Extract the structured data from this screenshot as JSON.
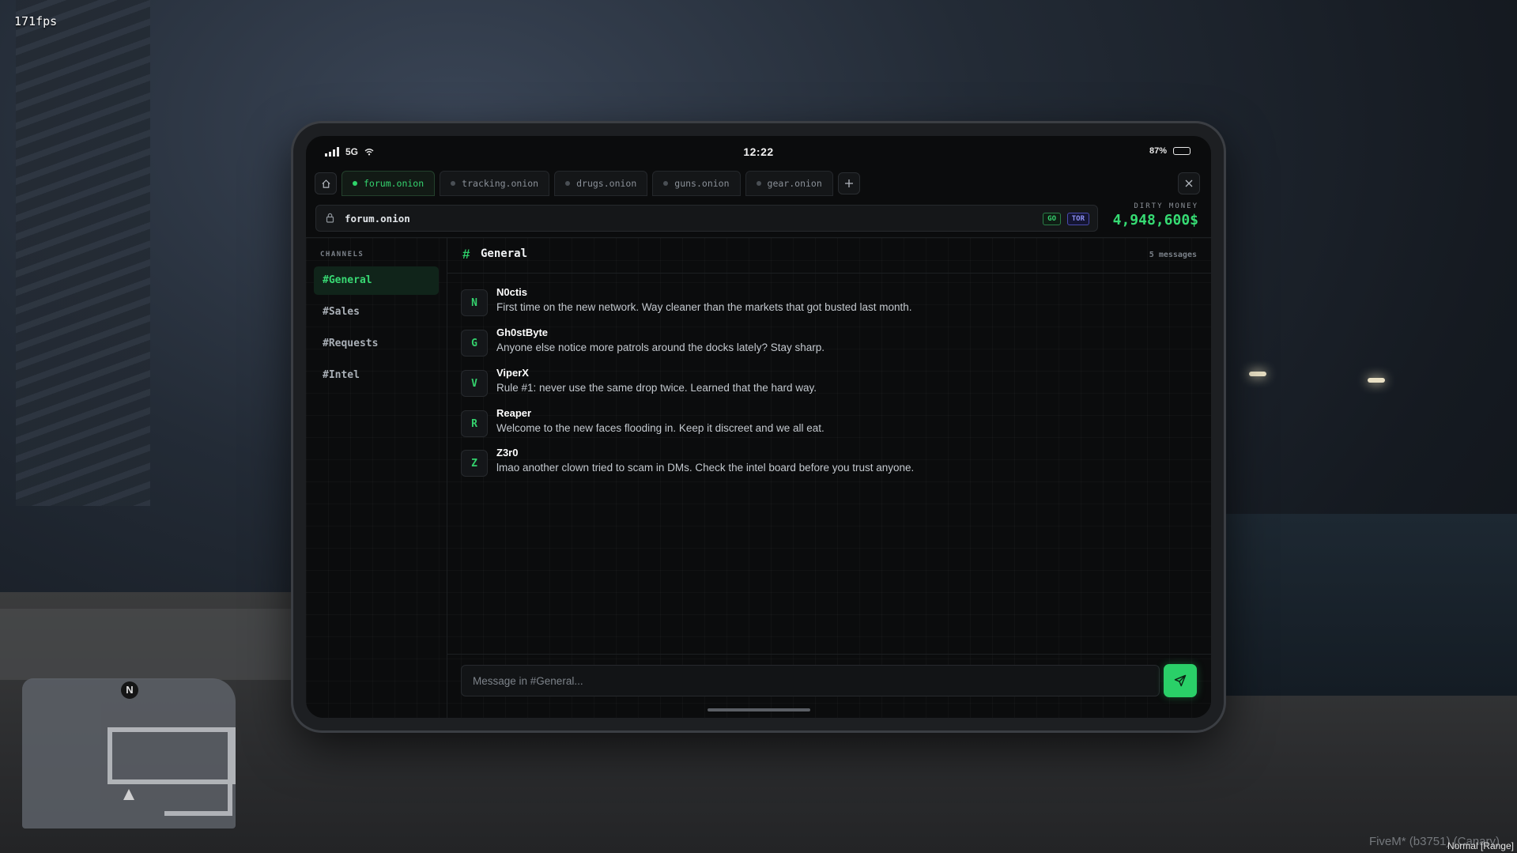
{
  "overlay": {
    "fps": "171fps",
    "watermark": "FiveM* (b3751) (Canary)",
    "voice_mode": "Normal [Range]",
    "minimap_north": "N"
  },
  "status_bar": {
    "signal_label": "5G",
    "time": "12:22",
    "battery_percent_label": "87%",
    "battery_level": 0.87
  },
  "tabs": [
    {
      "label": "forum.onion",
      "active": true
    },
    {
      "label": "tracking.onion",
      "active": false
    },
    {
      "label": "drugs.onion",
      "active": false
    },
    {
      "label": "guns.onion",
      "active": false
    },
    {
      "label": "gear.onion",
      "active": false
    }
  ],
  "url_bar": {
    "url": "forum.onion",
    "go_badge": "GO",
    "tor_badge": "TOR"
  },
  "wallet": {
    "label": "DIRTY MONEY",
    "amount": "4,948,600$"
  },
  "sidebar": {
    "title": "CHANNELS",
    "channels": [
      {
        "label": "#General",
        "active": true
      },
      {
        "label": "#Sales",
        "active": false
      },
      {
        "label": "#Requests",
        "active": false
      },
      {
        "label": "#Intel",
        "active": false
      }
    ]
  },
  "channel": {
    "hash": "#",
    "name": "General",
    "count": "5 messages"
  },
  "messages": [
    {
      "initial": "N",
      "author": "N0ctis",
      "text": "First time on the new network. Way cleaner than the markets that got busted last month."
    },
    {
      "initial": "G",
      "author": "Gh0stByte",
      "text": "Anyone else notice more patrols around the docks lately? Stay sharp."
    },
    {
      "initial": "V",
      "author": "ViperX",
      "text": "Rule #1: never use the same drop twice. Learned that the hard way."
    },
    {
      "initial": "R",
      "author": "Reaper",
      "text": "Welcome to the new faces flooding in. Keep it discreet and we all eat."
    },
    {
      "initial": "Z",
      "author": "Z3r0",
      "text": "lmao another clown tried to scam in DMs. Check the intel board before you trust anyone."
    }
  ],
  "composer": {
    "placeholder": "Message in #General..."
  },
  "colors": {
    "accent": "#2ad068",
    "tor": "#8c8ff2"
  },
  "icons": {
    "home": "home-icon",
    "add_tab": "plus-icon",
    "close": "close-icon",
    "lock": "lock-icon",
    "send": "send-icon",
    "wifi": "wifi-icon",
    "battery": "battery-icon",
    "signal": "signal-icon"
  }
}
